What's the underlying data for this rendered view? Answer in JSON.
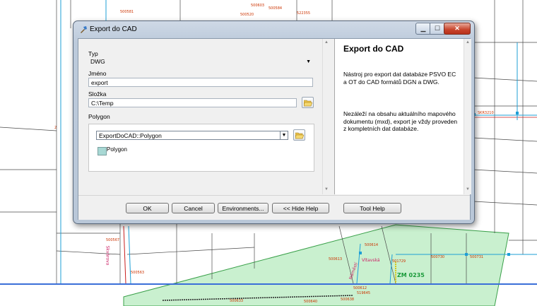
{
  "map": {
    "labels": [
      "500581",
      "500603",
      "500584",
      "522355",
      "500520",
      "500567",
      "500563",
      "500614",
      "500613",
      "500612",
      "500638",
      "500633",
      "500640",
      "519645",
      "501729",
      "500730",
      "500731",
      "SKR3210",
      "Vltavská",
      "Náměstí",
      "Skvárova",
      "ZM 0235",
      "2"
    ]
  },
  "dialog": {
    "title": "Export do CAD",
    "controls": {
      "minimize": "▁",
      "maximize": "☐",
      "close": "✕"
    },
    "form": {
      "typ_label": "Typ",
      "typ_value": "DWG",
      "jmeno_label": "Jméno",
      "jmeno_value": "export",
      "slozka_label": "Složka",
      "slozka_value": "C:\\Temp",
      "polygon_label": "Polygon",
      "polygon_value": "ExportDoCAD::Polygon",
      "polygon_layer": "Polygon"
    },
    "help": {
      "title": "Export do CAD",
      "paragraph1": "Nástroj pro export dat databáze PSVO EC a OT do CAD formátů DGN a DWG.",
      "paragraph2": "Nezáleží na obsahu aktuálního mapového dokumentu (mxd), export je vždy proveden z kompletních dat databáze."
    },
    "buttons": {
      "ok": "OK",
      "cancel": "Cancel",
      "environments": "Environments...",
      "hide_help": "<< Hide Help",
      "tool_help": "Tool Help"
    },
    "icons": [
      "app-tool-icon",
      "folder-open-icon",
      "dropdown-arrow-icon"
    ],
    "colors": {
      "polygon_fill": "#c9f0cf",
      "polygon_swatch": "#a8d8d4",
      "close_button": "#c7432b"
    }
  }
}
